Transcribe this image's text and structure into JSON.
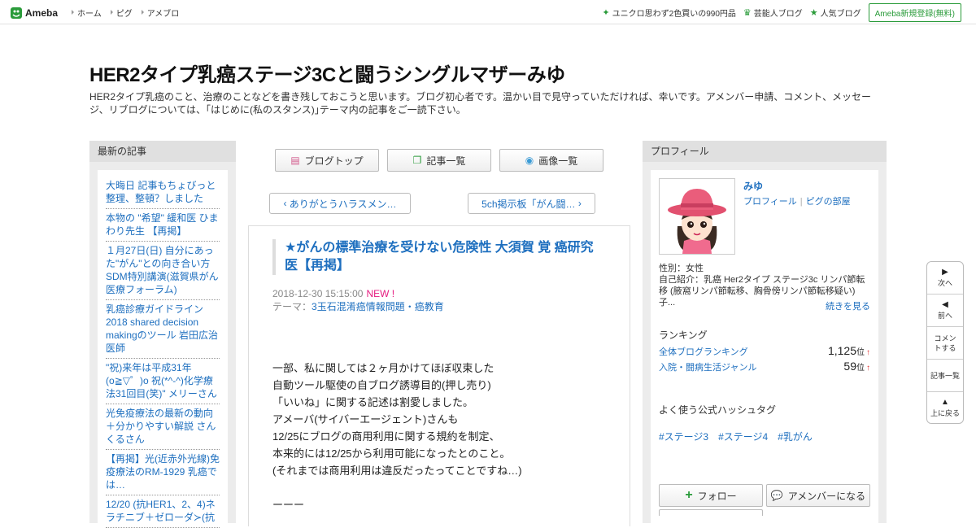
{
  "header": {
    "logo_text": "Ameba",
    "nav": [
      "ホーム",
      "ピグ",
      "アメブロ"
    ],
    "right_links": [
      {
        "icon": "sparkle-icon",
        "label": "ユニクロ思わず2色買いの990円品"
      },
      {
        "icon": "crown-icon",
        "label": "芸能人ブログ"
      },
      {
        "icon": "star-icon",
        "label": "人気ブログ"
      }
    ],
    "register_label": "Ameba新規登録(無料)"
  },
  "blog": {
    "title": "HER2タイプ乳癌ステージ3Cと闘うシングルマザーみゆ",
    "description": "HER2タイプ乳癌のこと、治療のことなどを書き残しておこうと思います。ブログ初心者です。温かい目で見守っていただければ、幸いです。アメンバー申請、コメント、メッセージ、リブログについては、｢はじめに(私のスタンス)｣テーマ内の記事をご一読下さい。"
  },
  "left": {
    "heading": "最新の記事",
    "items": [
      "大晦日 記事もちょびっと整理、整頓？しました",
      "本物の \"希望\" 緩和医 ひまわり先生 【再掲】",
      "１月27日(日) 自分にあった\"がん\"との向き合い方SDM特別講演(滋賀県がん医療フォーラム)",
      "乳癌診療ガイドライン2018 shared decision makingのツール 岩田広治医師",
      "\"祝)来年は平成31年(o≧▽゜)o 祝(*^-^)化学療法31回目(笑)\" メリーさん",
      "光免疫療法の最新の動向＋分かりやすい解説 さんくるさん",
      "【再掲】光(近赤外光線)免疫療法のRM-1929 乳癌では…",
      "12/20 (抗HER1、2、4)ネラチニブ＋ゼローダ≻(抗"
    ]
  },
  "toolbar": {
    "top": "ブログトップ",
    "list": "記事一覧",
    "images": "画像一覧"
  },
  "pager": {
    "prev": "ありがとうハラスメン…",
    "next": "5ch掲示板「がん闘…"
  },
  "article": {
    "title": "★がんの標準治療を受けない危険性 大須賀 覚 癌研究医【再掲】",
    "date": "2018-12-30 15:15:00",
    "new_label": "NEW !",
    "theme_label": "テーマ：",
    "theme": "3玉石混淆癌情報問題・癌教育",
    "lines": [
      "一部、私に関しては２ヶ月かけてほぼ収束した",
      "自動ツール駆使の自ブログ誘導目的(押し売り)",
      "「いいね」に関する記述は割愛しました。",
      "アメーバ(サイバーエージェント)さんも",
      "12/25にブログの商用利用に関する規約を制定、",
      "本来的には12/25から利用可能になったとのこと。",
      "(それまでは商用利用は違反だったってことですね…)",
      "",
      "ーーー"
    ]
  },
  "profile": {
    "heading": "プロフィール",
    "name": "みゆ",
    "link_profile": "プロフィール",
    "link_room": "ピグの部屋",
    "gender": "性別：女性",
    "intro": "自己紹介：乳癌 Her2タイプ ステージ3c リンパ節転移 (腋窩リンパ節転移、胸骨傍リンパ節転移疑い) 子...",
    "more": "続きを見る",
    "ranking_heading": "ランキング",
    "rankings": [
      {
        "label": "全体ブログランキング",
        "rank": "1,125",
        "unit": "位",
        "trend": "↑"
      },
      {
        "label": "入院・闘病生活ジャンル",
        "rank": "59",
        "unit": "位",
        "trend": "↑"
      }
    ],
    "hashtag_heading": "よく使う公式ハッシュタグ",
    "hashtags": [
      "#ステージ3",
      "#ステージ4",
      "#乳がん"
    ],
    "follow": "フォロー",
    "amember": "アメンバーになる"
  },
  "side": [
    {
      "icon": "next-icon",
      "label": "次へ"
    },
    {
      "icon": "prev-icon",
      "label": "前へ"
    },
    {
      "icon": "",
      "label": "コメントする"
    },
    {
      "icon": "",
      "label": "記事一覧"
    },
    {
      "icon": "top-icon",
      "label": "上に戻る"
    }
  ]
}
